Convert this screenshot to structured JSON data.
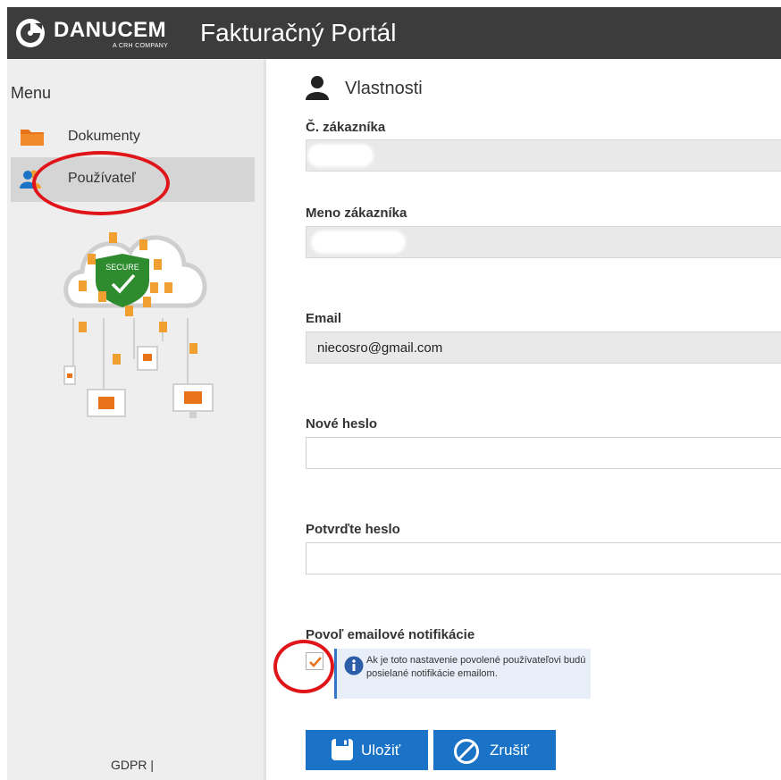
{
  "header": {
    "brand": "DANUCEM",
    "brand_sub": "A CRH COMPANY",
    "title": "Fakturačný Portál"
  },
  "sidebar": {
    "menu_title": "Menu",
    "items": [
      {
        "label": "Dokumenty",
        "icon": "folder-icon",
        "active": false
      },
      {
        "label": "Používateľ",
        "icon": "users-icon",
        "active": true
      }
    ],
    "illustration": {
      "badge_text": "SECURE"
    },
    "footer": "GDPR |"
  },
  "main": {
    "section_title": "Vlastnosti",
    "fields": {
      "customer_no": {
        "label": "Č. zákazníka",
        "value": ""
      },
      "customer_name": {
        "label": "Meno zákazníka",
        "value": ""
      },
      "email": {
        "label": "Email",
        "value": "niecosro@gmail.com"
      },
      "new_password": {
        "label": "Nové heslo",
        "value": ""
      },
      "confirm_password": {
        "label": "Potvrďte heslo",
        "value": ""
      }
    },
    "notifications": {
      "label": "Povoľ emailové notifikácie",
      "checked": true,
      "info": "Ak je toto nastavenie povolené používateľovi budú posielané notifikácie emailom."
    },
    "buttons": {
      "save": "Uložiť",
      "cancel": "Zrušiť"
    }
  },
  "colors": {
    "header_bg": "#3c3c3c",
    "accent_blue": "#1a73c6",
    "folder_orange": "#f0a030",
    "check_orange": "#e8731a",
    "annotation_red": "#e0151a"
  }
}
